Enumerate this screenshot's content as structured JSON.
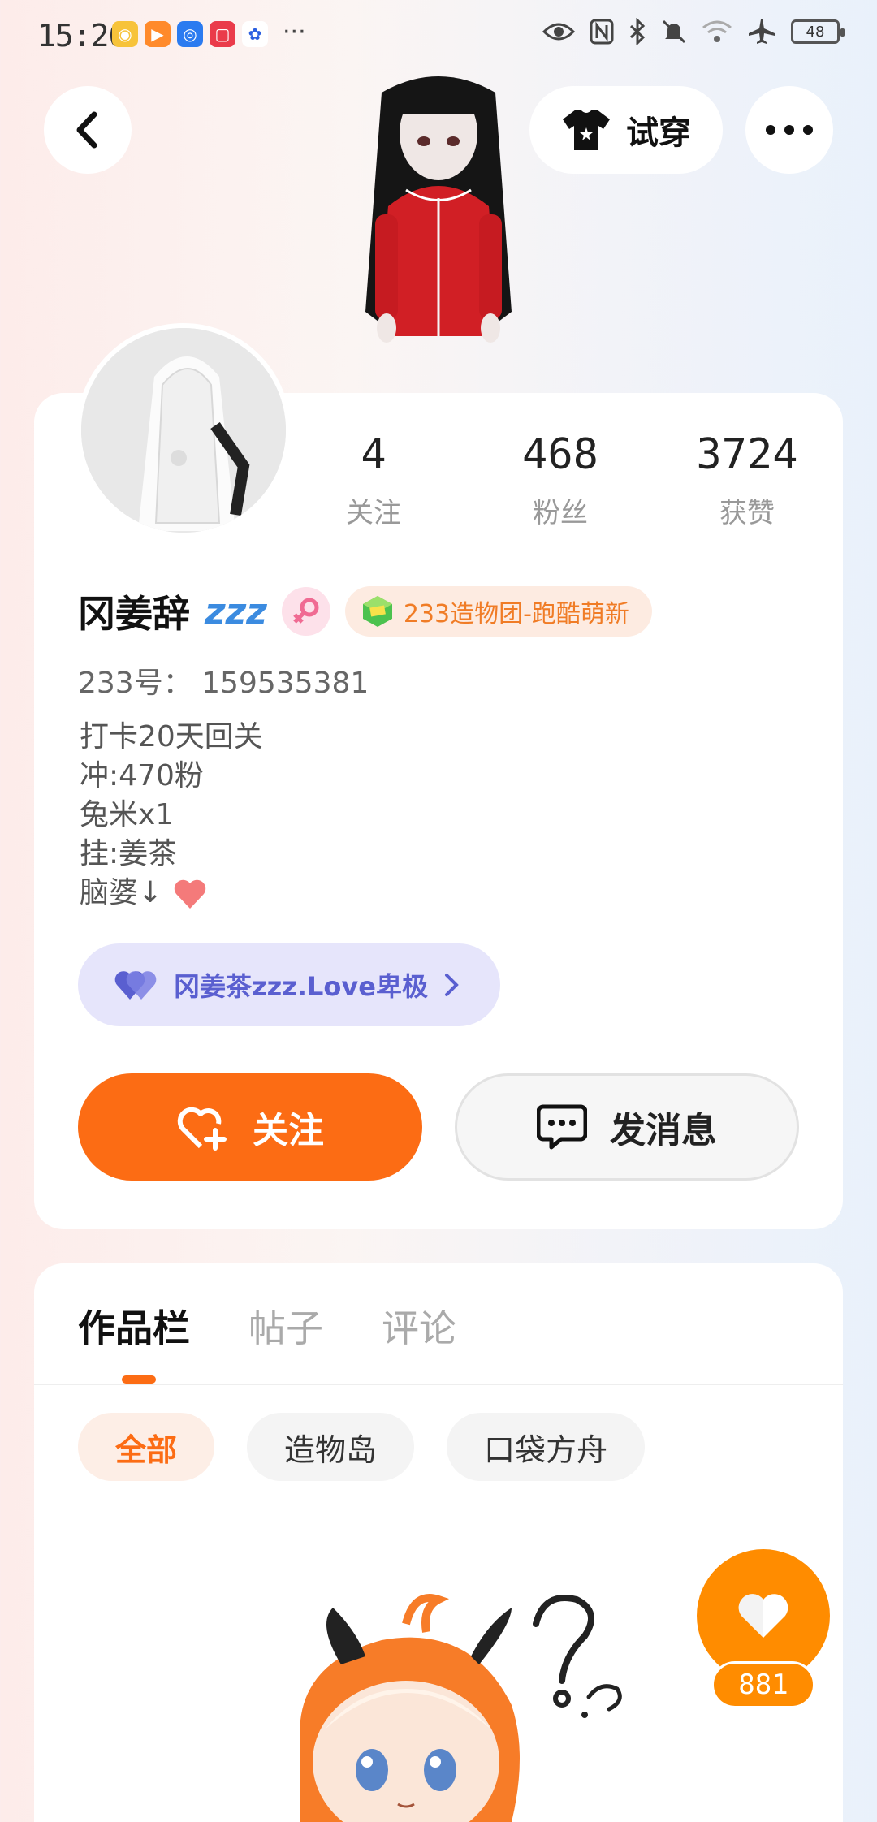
{
  "status_bar": {
    "time": "15:26",
    "battery": "48"
  },
  "header": {
    "try_on_label": "试穿"
  },
  "profile": {
    "stats": [
      {
        "value": "4",
        "label": "关注"
      },
      {
        "value": "468",
        "label": "粉丝"
      },
      {
        "value": "3724",
        "label": "获赞"
      }
    ],
    "username": "冈姜辞",
    "username_suffix": "zzz",
    "team_badge": "233造物团-跑酷萌新",
    "id_line": "233号： 159535381",
    "bio": [
      "打卡20天回关",
      "冲:470粉",
      "兔米x1",
      "挂:姜茶",
      "脑婆↓"
    ],
    "fan_badge": "冈姜茶zzz.Love卑极",
    "follow_label": "关注",
    "message_label": "发消息"
  },
  "works": {
    "tabs": [
      "作品栏",
      "帖子",
      "评论"
    ],
    "chips": [
      "全部",
      "造物岛",
      "口袋方舟"
    ],
    "like_count": "881"
  }
}
